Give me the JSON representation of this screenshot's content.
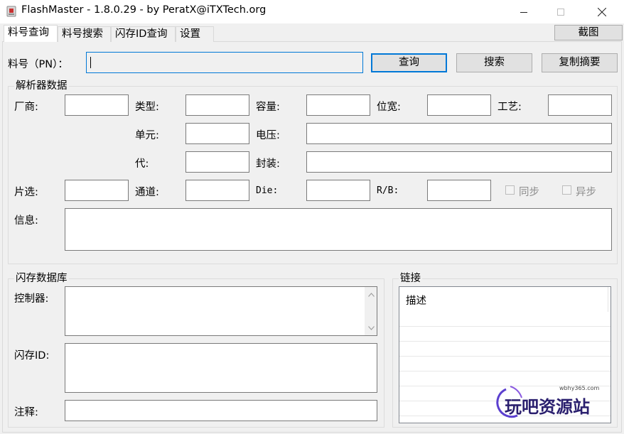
{
  "window": {
    "title": "FlashMaster - 1.8.0.29 - by PeratX@iTXTech.org",
    "minimize_icon": "minimize-icon",
    "maximize_icon": "maximize-icon",
    "close_icon": "close-icon"
  },
  "tabs": [
    {
      "label": "料号查询",
      "active": true
    },
    {
      "label": "料号搜索",
      "active": false
    },
    {
      "label": "闪存ID查询",
      "active": false
    },
    {
      "label": "设置",
      "active": false
    }
  ],
  "screenshot_button": "截图",
  "pn_row": {
    "label": "料号（PN）：",
    "value": "",
    "query_button": "查询",
    "search_button": "搜索",
    "copy_summary_button": "复制摘要"
  },
  "parser": {
    "title": "解析器数据",
    "vendor": "厂商:",
    "type": "类型:",
    "capacity": "容量:",
    "width": "位宽:",
    "process": "工艺:",
    "cell": "单元:",
    "voltage": "电压:",
    "generation": "代:",
    "package": "封装:",
    "chip_select": "片选:",
    "channel": "通道:",
    "die": "Die:",
    "rb": "R/B:",
    "sync": "同步",
    "async": "异步",
    "info": "信息:"
  },
  "flash_db": {
    "title": "闪存数据库",
    "controller": "控制器:",
    "flash_id": "闪存ID:",
    "notes": "注释:"
  },
  "links": {
    "title": "链接",
    "column_description": "描述"
  },
  "watermark": {
    "url": "wbhy365.com",
    "text": "玩吧资源站"
  }
}
